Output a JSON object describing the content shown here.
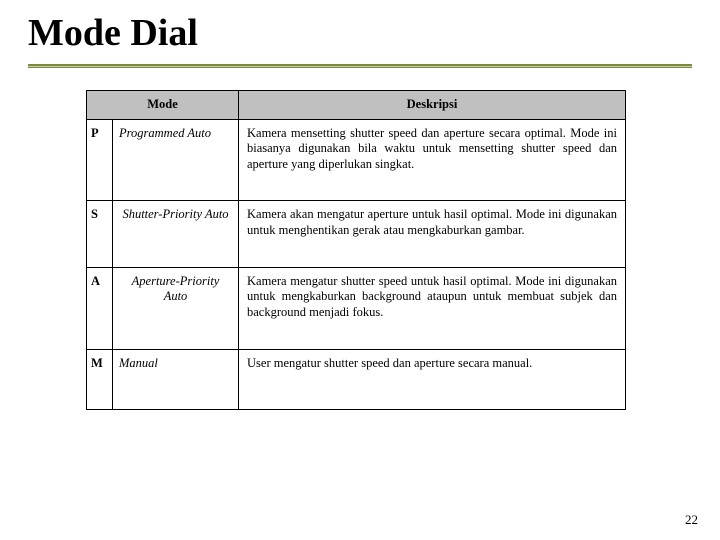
{
  "title": "Mode Dial",
  "page_number": "22",
  "table": {
    "headers": {
      "mode": "Mode",
      "deskripsi": "Deskripsi"
    },
    "rows": [
      {
        "code": "P",
        "name": "Programmed Auto",
        "desc": "Kamera mensetting shutter speed dan aperture secara optimal. Mode ini biasanya digunakan bila waktu untuk mensetting shutter speed dan aperture yang diperlukan singkat."
      },
      {
        "code": "S",
        "name": "Shutter-Priority Auto",
        "desc": "Kamera akan mengatur aperture untuk hasil optimal. Mode ini digunakan untuk menghentikan gerak atau mengkaburkan gambar."
      },
      {
        "code": "A",
        "name": "Aperture-Priority Auto",
        "desc": "Kamera mengatur shutter speed untuk hasil optimal. Mode ini digunakan untuk mengkaburkan background ataupun untuk membuat subjek dan background menjadi fokus."
      },
      {
        "code": "M",
        "name": "Manual",
        "desc": "User mengatur shutter speed dan aperture secara manual."
      }
    ]
  }
}
